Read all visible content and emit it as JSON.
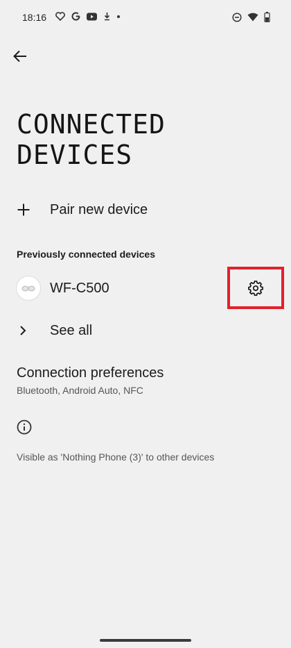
{
  "status_bar": {
    "time": "18:16",
    "left_icons": [
      "heart-shield-icon",
      "google-icon",
      "youtube-icon",
      "download-icon",
      "dot-icon"
    ],
    "right_icons": [
      "do-not-disturb-icon",
      "wifi-icon",
      "battery-icon"
    ]
  },
  "header": {
    "title_line1": "CONNECTED",
    "title_line2": "DEVICES"
  },
  "pair": {
    "label": "Pair new device"
  },
  "previous": {
    "section_label": "Previously connected devices",
    "device_name": "WF-C500",
    "see_all_label": "See all"
  },
  "preferences": {
    "title": "Connection preferences",
    "subtitle": "Bluetooth, Android Auto, NFC"
  },
  "info": {
    "visible_text": "Visible as 'Nothing Phone (3)' to other devices"
  },
  "colors": {
    "highlight": "#e3202b",
    "background": "#f0f0f0"
  }
}
